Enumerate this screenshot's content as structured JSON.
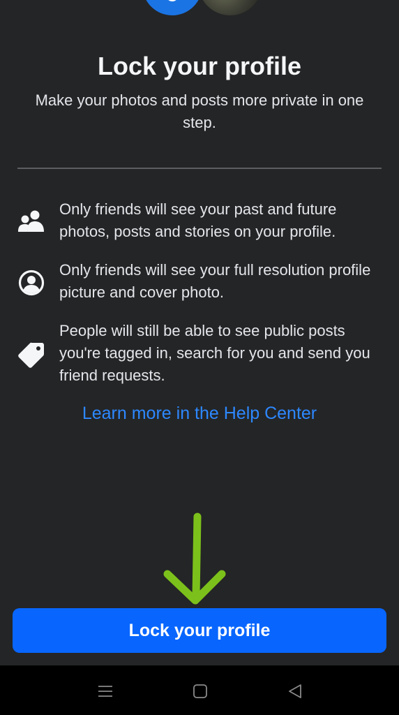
{
  "header": {
    "title": "Lock your profile",
    "subtitle": "Make your photos and posts more private in one step."
  },
  "features": [
    {
      "icon": "friends-icon",
      "text": "Only friends will see your past and future photos, posts and stories on your profile."
    },
    {
      "icon": "profile-circle-icon",
      "text": "Only friends will see your full resolution profile picture and cover photo."
    },
    {
      "icon": "tag-icon",
      "text": "People will still be able to see public posts you're tagged in, search for you and send you friend requests."
    }
  ],
  "help": {
    "link_label": "Learn more in the Help Center"
  },
  "actions": {
    "primary_label": "Lock your profile"
  },
  "colors": {
    "background": "#242526",
    "accent": "#0866ff",
    "link": "#2d88ff",
    "annotation_arrow": "#7cc11b"
  },
  "system_nav": {
    "icons": [
      "recents-menu-icon",
      "home-square-icon",
      "back-triangle-icon"
    ]
  }
}
